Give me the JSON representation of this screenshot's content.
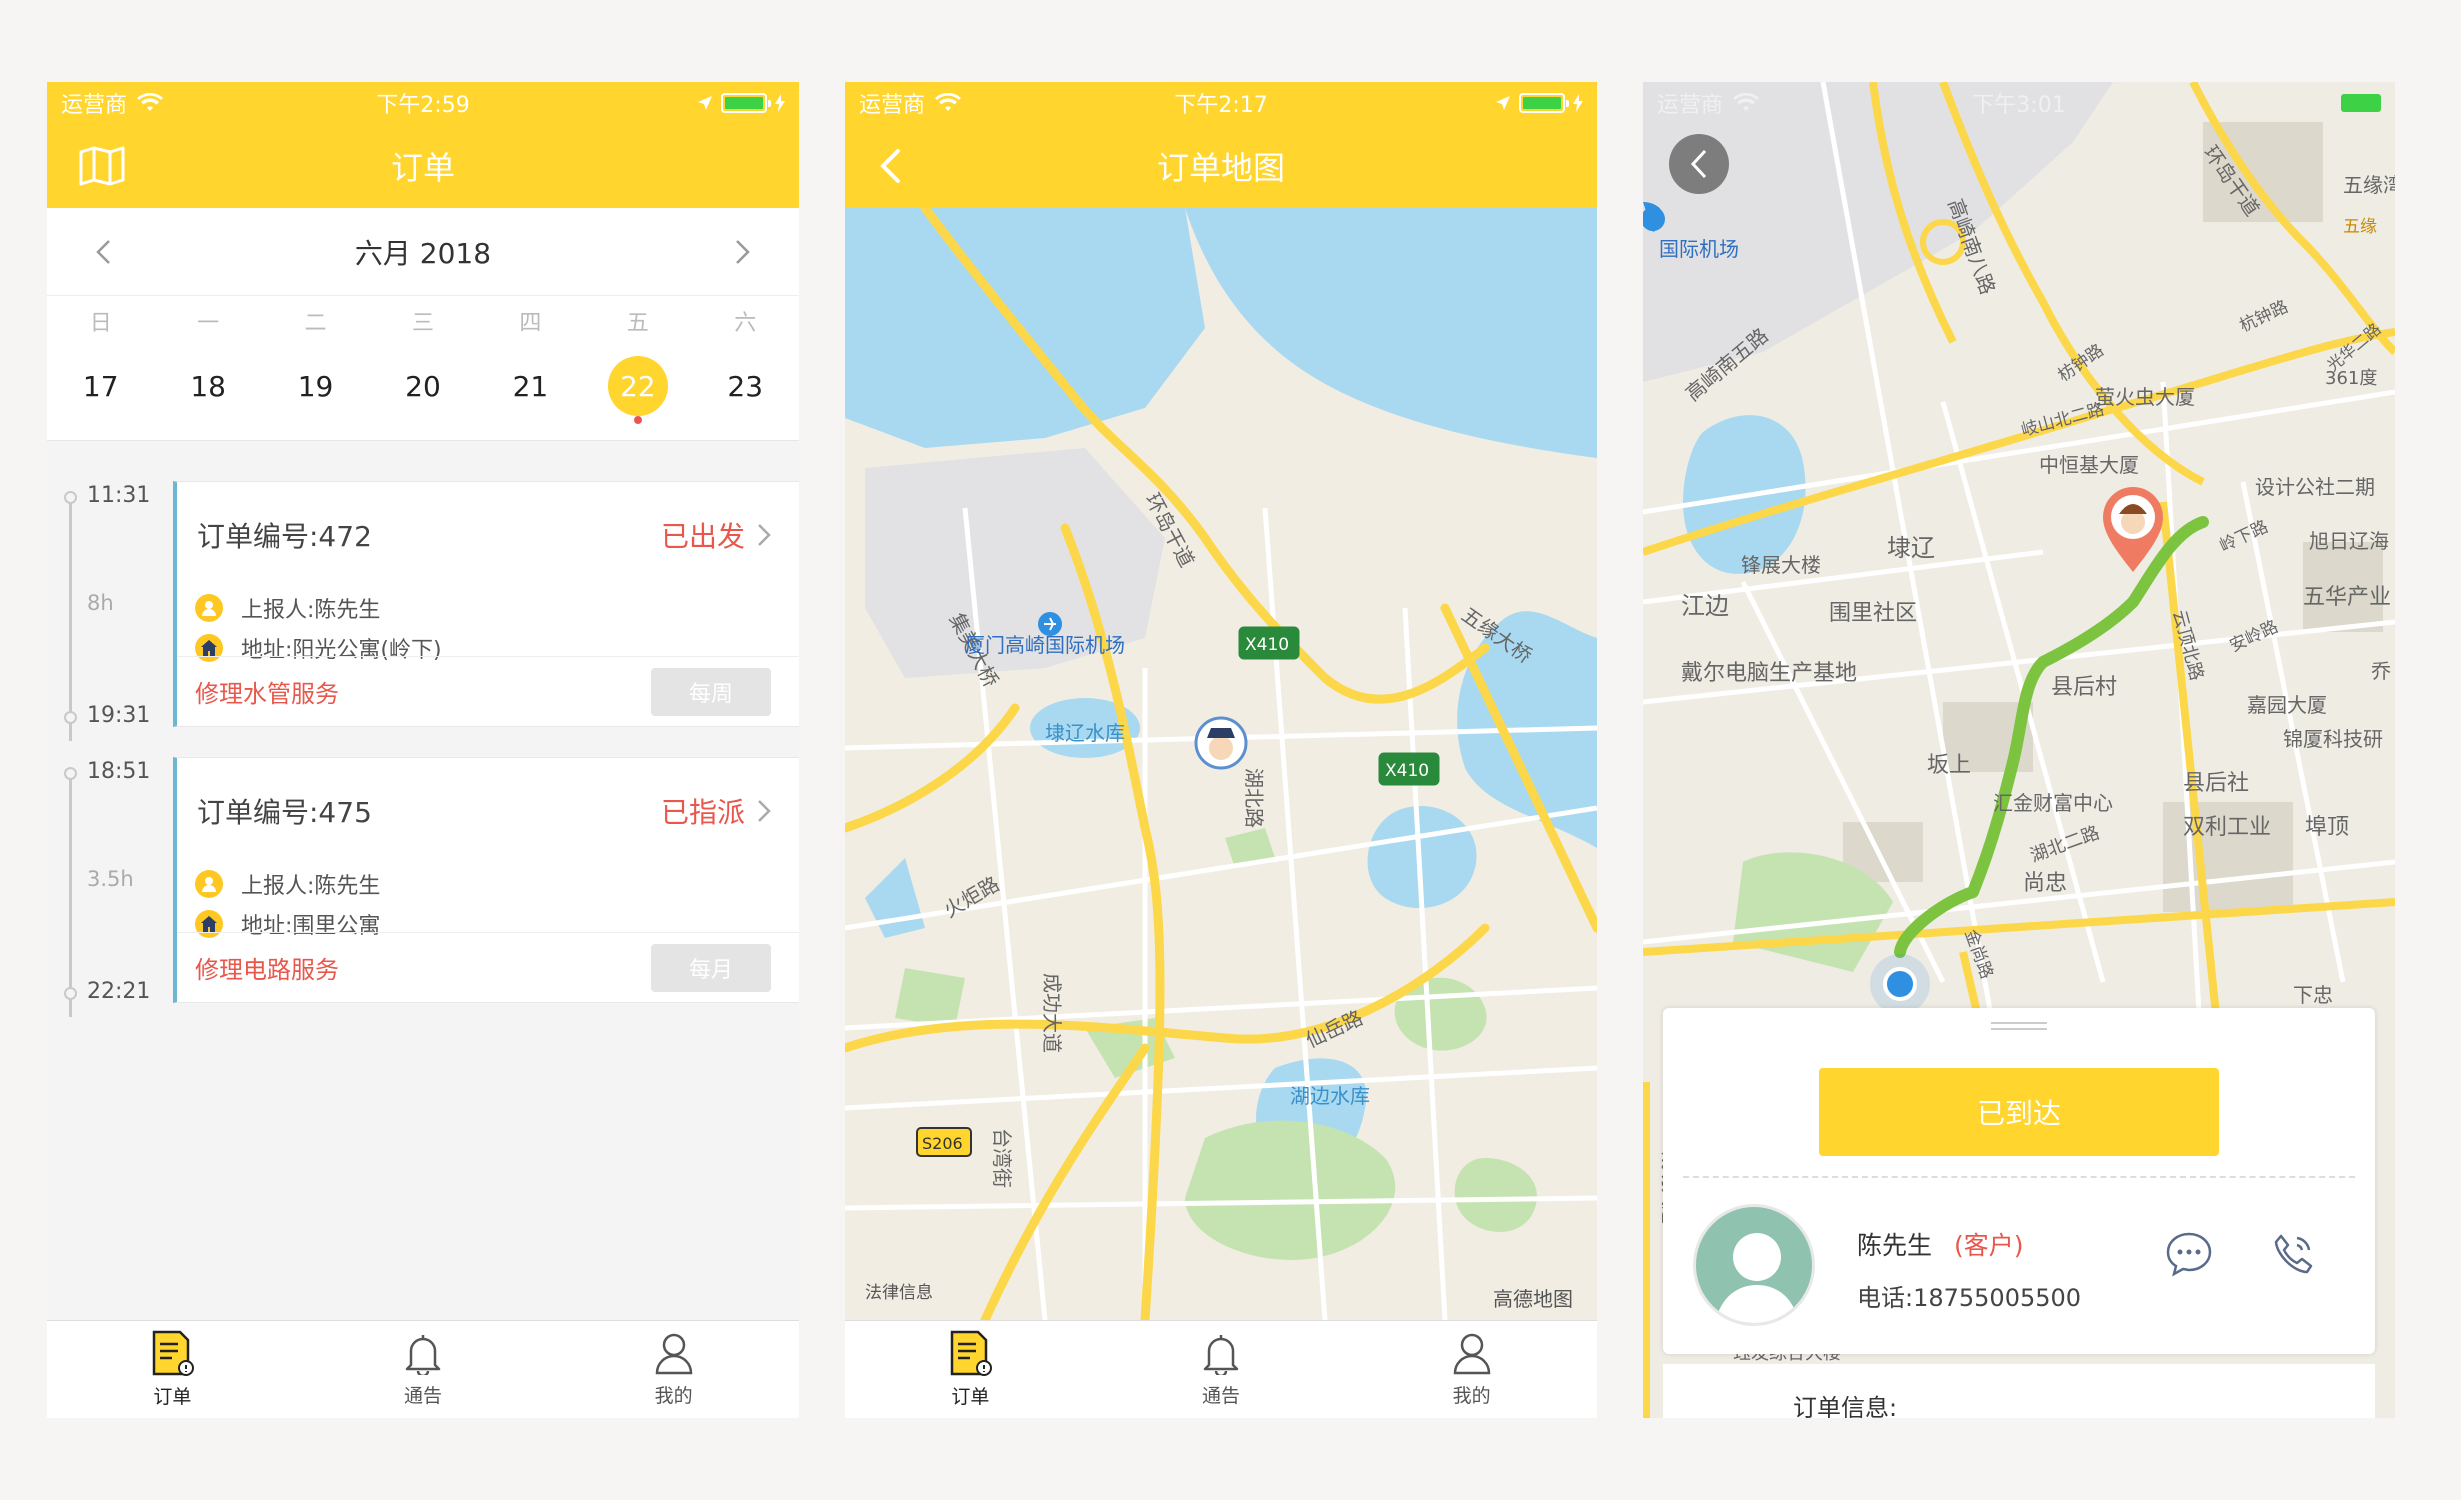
{
  "colors": {
    "brand": "#ffd52e",
    "status_red": "#e8574c",
    "route_green": "#7cc33f"
  },
  "screen1": {
    "status": {
      "carrier": "运营商",
      "time": "下午2:59"
    },
    "nav": {
      "title": "订单",
      "left_icon": "map-icon"
    },
    "calendar": {
      "month": "六月 2018",
      "weekdays": [
        "日",
        "一",
        "二",
        "三",
        "四",
        "五",
        "六"
      ],
      "dates": [
        "17",
        "18",
        "19",
        "20",
        "21",
        "22",
        "23"
      ],
      "selected": "22"
    },
    "orders": [
      {
        "start": "11:31",
        "duration": "8h",
        "end": "19:31",
        "title": "订单编号:472",
        "status": "已出发",
        "reporter": "上报人:陈先生",
        "address": "地址:阳光公寓(岭下)",
        "service": "修理水管服务",
        "frequency": "每周"
      },
      {
        "start": "18:51",
        "duration": "3.5h",
        "end": "22:21",
        "title": "订单编号:475",
        "status": "已指派",
        "reporter": "上报人:陈先生",
        "address": "地址:围里公寓",
        "service": "修理电路服务",
        "frequency": "每月"
      }
    ],
    "tabs": {
      "orders": "订单",
      "notice": "通告",
      "mine": "我的"
    }
  },
  "screen2": {
    "status": {
      "carrier": "运营商",
      "time": "下午2:17"
    },
    "nav": {
      "title": "订单地图"
    },
    "map": {
      "airport": "厦门高崎国际机场",
      "reservoir1": "埭辽水库",
      "reservoir2": "湖边水库",
      "road1": "集美大桥",
      "road2": "环岛干道",
      "road3": "五缘大桥",
      "road4": "成功大道",
      "road5": "仙岳路",
      "road6": "火炬路",
      "road7": "台湾街",
      "road8": "湖北路",
      "shield1": "X410",
      "shield2": "X410",
      "shield3": "S206",
      "legal": "法律信息",
      "provider": "高德地图"
    },
    "tabs": {
      "orders": "订单",
      "notice": "通告",
      "mine": "我的"
    }
  },
  "screen3": {
    "status": {
      "carrier": "运营商",
      "time": "下午3:01"
    },
    "map": {
      "l1": "高崎南八路",
      "l2": "环岛干道",
      "l3": "五缘湾",
      "l4": "国际机场",
      "l5": "高崎南五路",
      "l6": "杭钟路",
      "l7": "枋钟路",
      "l8": "萤火虫大厦",
      "l9": "361度",
      "l10": "岐山北二路",
      "l11": "中恒基大厦",
      "l12": "设计公社二期",
      "l13": "锋展大楼",
      "l14": "埭辽",
      "l15": "岭下路",
      "l16": "旭日辽海",
      "l17": "江边",
      "l18": "围里社区",
      "l19": "五华产业",
      "l20": "戴尔电脑生产基地",
      "l21": "县后村",
      "l22": "安岭路",
      "l23": "嘉园大厦",
      "l24": "锦厦科技研",
      "l25": "坂上",
      "l26": "汇金财富中心",
      "l27": "县后社",
      "l28": "双利工业",
      "l29": "埠顶",
      "l30": "湖北二路",
      "l31": "尚忠",
      "l32": "金尚路",
      "l33": "云顶北路",
      "l34": "成功大道",
      "l35": "珏发综合大楼",
      "l36": "五缘",
      "l37": "光华二路",
      "l38": "乔",
      "l39": "下忠"
    },
    "sheet": {
      "arrive": "已到达",
      "name": "陈先生",
      "role": "(客户)",
      "phone": "电话:18755005500"
    },
    "below": "订单信息:"
  }
}
